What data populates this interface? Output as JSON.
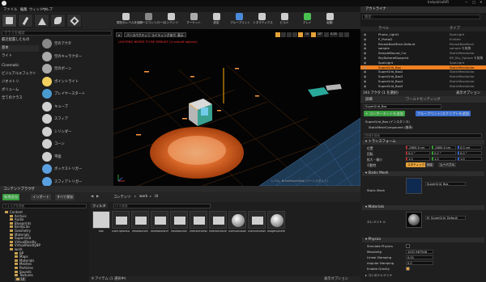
{
  "title": {
    "app": "IndustrialVR"
  },
  "menu": [
    "ファイル",
    "編集",
    "ウィンドウ",
    "ヘルプ"
  ],
  "modes_panel": {
    "search_placeholder": "クラスを検索",
    "categories": [
      "最近配置したもの",
      "基本",
      "ライト",
      "Cinematic",
      "ビジュアルエフェクト",
      "ジオメトリ",
      "ボリューム",
      "全てのクラス"
    ],
    "selected_category": 1,
    "items": [
      "空のアクタ",
      "空のキャラクター",
      "空のポーン",
      "ポイントライト",
      "プレイヤースタート",
      "キューブ",
      "スフィア",
      "シリンダー",
      "コーン",
      "平面",
      "ボックストリガー",
      "スフィアトリガー"
    ]
  },
  "toolbar": [
    "現在のレベルを保存",
    "ソースコントロール",
    "コンテンツ",
    "マーケット",
    "設定",
    "ブループリント",
    "シネマティクス",
    "ビルド",
    "プレイ",
    "起動"
  ],
  "viewport": {
    "btn_perspective": "パースペクティブ",
    "btn_lit": "ライティングあり",
    "btn_show": "表示",
    "warning": "LIGHTING NEEDS TO BE REBUILT (4 unbuilt objects)",
    "level": "レベル: BreakRoomMap (パーシスタント)"
  },
  "outliner": {
    "header": "アウトライナ",
    "search_placeholder": "検索...",
    "col_label": "ラベル",
    "col_type": "タイプ",
    "rows": [
      {
        "name": "Phone_Light1",
        "type": "SpotLight"
      },
      {
        "name": "P_Portal2",
        "type": "Emitter"
      },
      {
        "name": "RecastNavMesh-Default",
        "type": "RecastNavMesh"
      },
      {
        "name": "sample",
        "type": "sample を編集"
      },
      {
        "name": "SampleBound_Cur",
        "type": "StaticMeshActor"
      },
      {
        "name": "SkySphereBlueprint",
        "type": "BP_Sky_Sphere を編集"
      },
      {
        "name": "SpotLight",
        "type": "SpotLight"
      },
      {
        "name": "SuperGrid_Box",
        "type": "StaticMeshActor"
      },
      {
        "name": "SuperGrid_Box2",
        "type": "StaticMeshActor"
      },
      {
        "name": "SuperGrid_Box3",
        "type": "StaticMeshActor"
      },
      {
        "name": "SuperGrid_Box4",
        "type": "StaticMeshActor"
      },
      {
        "name": "SuperGrid_Box5",
        "type": "StaticMeshActor"
      }
    ],
    "selected_row": 7,
    "footer": "193 アクタ (1 を選択)",
    "view_options": "表示オプション"
  },
  "details": {
    "tab_details": "詳細",
    "tab_world": "ワールドセッティング",
    "actor_name": "SuperGrid_Box",
    "add_component": "+ コンポーネントを追加",
    "bp_button": "ブループリント/スクリプトを追加",
    "components": [
      "SuperGrid_Box (インスタンス)",
      "StaticMeshComponent (継承)"
    ],
    "search_placeholder": "詳細を検索",
    "transform_header": "トランスフォーム",
    "transform_labels": [
      "位置",
      "回転",
      "拡大・縮小"
    ],
    "location": [
      "-2800.0 cm",
      "-2800.0 cm",
      "0.0 cm"
    ],
    "rotation": [
      "0.0 °",
      "0.0 °",
      "0.0 °"
    ],
    "scale": [
      "1.0",
      "1.0",
      "1.0"
    ],
    "mobility_label": "可動性",
    "mobility": [
      "スタティック",
      "固定",
      "ムーバブル"
    ],
    "static_mesh_header": "Static Mesh",
    "static_mesh_label": "Static Mesh",
    "static_mesh_value": "SuperGrid_Box",
    "materials_header": "Materials",
    "element_label": "エレメント 0",
    "material_value": "M_SuperGrid_Default",
    "physics_header": "Physics",
    "physics_labels": [
      "Simulate Physics",
      "MassInKg",
      "Linear Damping",
      "Angular Damping",
      "Enable Gravity"
    ],
    "physics_values": [
      "",
      "1037.987548",
      "0.01",
      "0.0",
      ""
    ],
    "constraints": "コンストレイント"
  },
  "content_browser": {
    "tab": "コンテンツブラウザ",
    "add_new": "新規追加",
    "import": "インポート",
    "save_all": "すべて保存",
    "path": [
      "コンテンツ",
      "work",
      "UI"
    ],
    "filters": "フィルタ",
    "search_placeholder": "UI の検索",
    "tree_search": "フォルダを検索",
    "tree": [
      "Content",
      "Archvis",
      "Audio",
      "Blueprints",
      "BrollyLite",
      "Geometry",
      "Materials",
      "SuperGrid",
      "VirtualReality",
      "VirtualRealityBP",
      "work",
      "BP",
      "Maps",
      "Materials",
      "Meshes",
      "Particles",
      "Sounds",
      "Textures",
      "UI"
    ],
    "assets": [
      "bak",
      "UserOptionsData",
      "ResetButton",
      "ResetButtonProp",
      "ResetButton",
      "InteractiveWidget",
      "InteractiveDefaultStruct",
      "UserStatusWidget",
      "UserStatusWidget",
      "widgetSphere"
    ],
    "status": "9 アイテム (1 選択中)",
    "view_options": "表示オプション"
  }
}
